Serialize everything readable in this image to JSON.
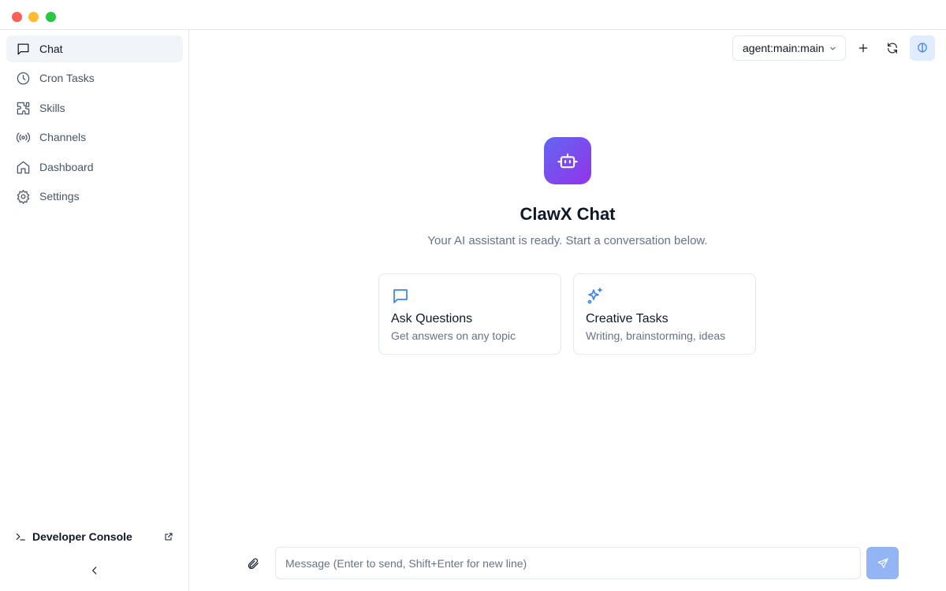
{
  "colors": {
    "accent": "#3b82f6",
    "logo_gradient_start": "#6366f1",
    "logo_gradient_end": "#9333ea",
    "send_button": "#93b4f5",
    "traffic_close": "#ff5f57",
    "traffic_minimize": "#febc2e",
    "traffic_maximize": "#28c840"
  },
  "sidebar": {
    "items": [
      {
        "label": "Chat",
        "icon": "message-square-icon",
        "active": true
      },
      {
        "label": "Cron Tasks",
        "icon": "clock-icon",
        "active": false
      },
      {
        "label": "Skills",
        "icon": "puzzle-icon",
        "active": false
      },
      {
        "label": "Channels",
        "icon": "radio-icon",
        "active": false
      },
      {
        "label": "Dashboard",
        "icon": "home-icon",
        "active": false
      },
      {
        "label": "Settings",
        "icon": "gear-icon",
        "active": false
      }
    ],
    "developer_console": {
      "label": "Developer Console",
      "icon": "terminal-icon",
      "trailing_icon": "external-link-icon"
    },
    "collapse_icon": "chevron-left-icon"
  },
  "header": {
    "agent_select": {
      "value": "agent:main:main",
      "icon": "chevron-down-icon"
    },
    "new_chat_icon": "plus-icon",
    "refresh_icon": "refresh-icon",
    "thinking_icon": "brain-icon"
  },
  "welcome": {
    "logo_icon": "bot-icon",
    "title": "ClawX Chat",
    "subtitle": "Your AI assistant is ready. Start a conversation below.",
    "cards": [
      {
        "title": "Ask Questions",
        "description": "Get answers on any topic",
        "icon": "message-square-icon"
      },
      {
        "title": "Creative Tasks",
        "description": "Writing, brainstorming, ideas",
        "icon": "sparkles-icon"
      }
    ]
  },
  "composer": {
    "attach_icon": "paperclip-icon",
    "placeholder": "Message (Enter to send, Shift+Enter for new line)",
    "value": "",
    "send_icon": "send-icon"
  }
}
